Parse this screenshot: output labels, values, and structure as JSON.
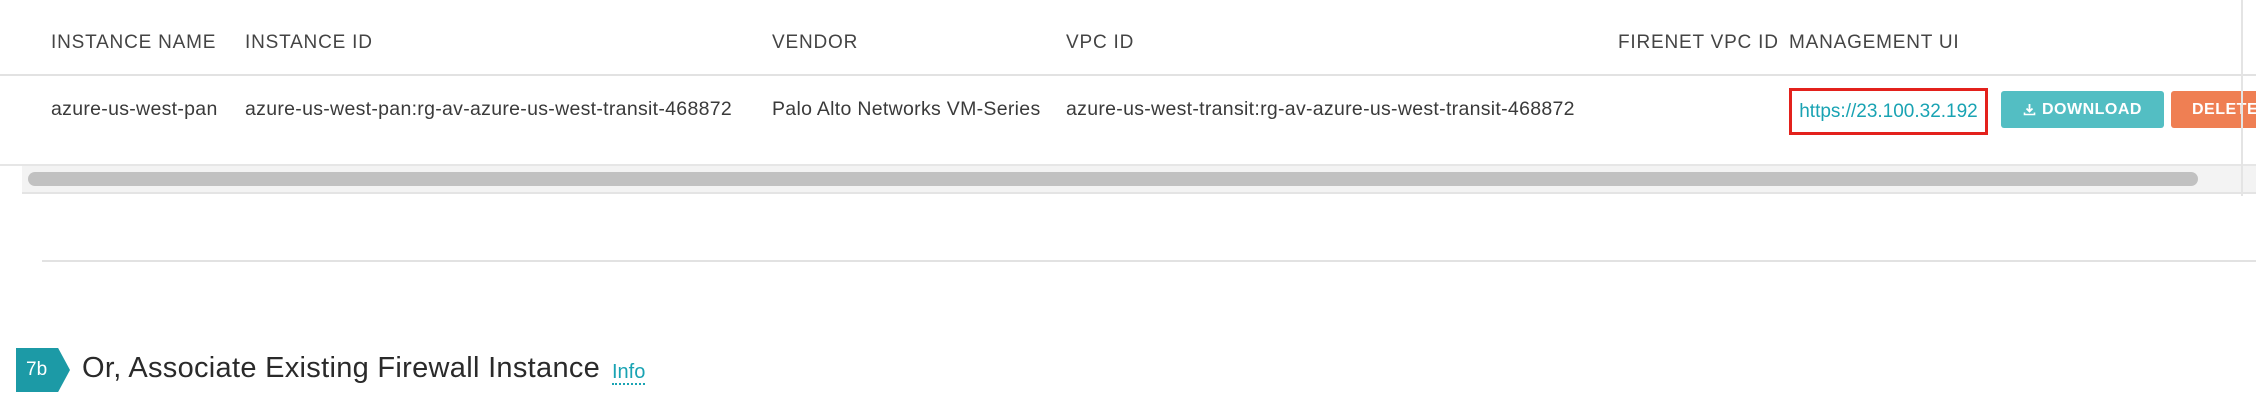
{
  "table": {
    "headers": {
      "instance_name": "INSTANCE NAME",
      "instance_id": "INSTANCE ID",
      "vendor": "VENDOR",
      "vpc_id": "VPC ID",
      "firenet_vpc_id": "FIRENET VPC ID",
      "management_ui": "MANAGEMENT UI"
    },
    "rows": [
      {
        "instance_name": "azure-us-west-pan",
        "instance_id": "azure-us-west-pan:rg-av-azure-us-west-transit-468872",
        "vendor": "Palo Alto Networks VM-Series",
        "vpc_id": "azure-us-west-transit:rg-av-azure-us-west-transit-468872",
        "firenet_vpc_id": "",
        "management_ui": "https://23.100.32.192",
        "download_label": "DOWNLOAD",
        "delete_label": "DELETE"
      }
    ]
  },
  "section": {
    "step": "7b",
    "title": "Or, Associate Existing Firewall Instance",
    "info_label": "Info"
  },
  "colors": {
    "accent": "#1c9aa6",
    "link": "#19a3b3",
    "download": "#53bec3",
    "delete": "#ef7f53",
    "highlight": "#e3211c"
  },
  "icons": {
    "download": "download-icon"
  }
}
